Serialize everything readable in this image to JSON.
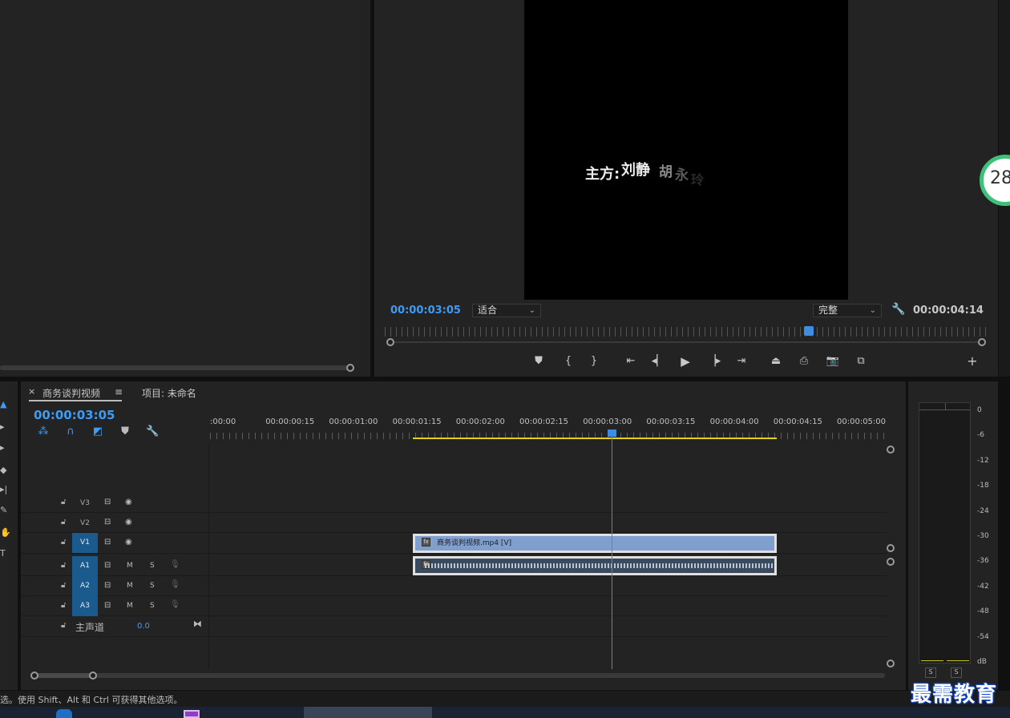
{
  "program": {
    "title_text": {
      "part1": "主方:",
      "part2": "刘静",
      "part3": "胡",
      "part4": "永",
      "part5": "玲"
    },
    "timecode": "00:00:03:05",
    "fit_select": "适合",
    "quality_select": "完整",
    "duration": "00:00:04:14"
  },
  "badge": {
    "text": "28"
  },
  "timeline": {
    "tab_sequence": "商务谈判视频",
    "tab_close": "×",
    "tab_menu": "≡",
    "tab_project": "项目: 未命名",
    "timecode": "00:00:03:05",
    "ruler_labels": [
      ":00:00",
      "00:00:00:15",
      "00:00:01:00",
      "00:00:01:15",
      "00:00:02:00",
      "00:00:02:15",
      "00:00:03:00",
      "00:00:03:15",
      "00:00:04:00",
      "00:00:04:15",
      "00:00:05:00"
    ],
    "tracks": {
      "v3": "V3",
      "v2": "V2",
      "v1": "V1",
      "a1": "A1",
      "a2": "A2",
      "a3": "A3",
      "master": "主声道",
      "master_value": "0.0",
      "mute": "M",
      "solo": "S"
    },
    "video_clip": "商务谈判视频.mp4 [V]",
    "fx": "fx"
  },
  "meter": {
    "db_labels": [
      "0",
      "-6",
      "-12",
      "-18",
      "-24",
      "-30",
      "-36",
      "-42",
      "-48",
      "-54",
      "dB"
    ],
    "solo_left": "S",
    "solo_right": "S"
  },
  "status": {
    "text": "选。使用 Shift、Alt 和 Ctrl 可获得其他选项。"
  },
  "watermark": {
    "text": "最需教育"
  },
  "colors": {
    "accent_blue": "#3e9cf5",
    "workarea_yellow": "#e5d11a",
    "clip_video": "#7f9fcf"
  }
}
